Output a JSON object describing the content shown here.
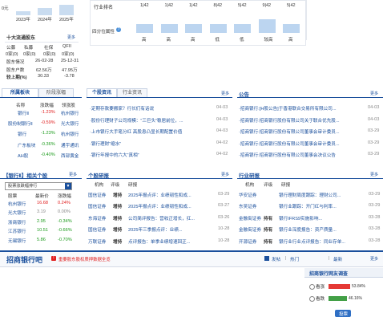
{
  "top_left": {
    "cell_label": "0元",
    "year_labels": [
      "2023年",
      "2024年",
      "2025年"
    ],
    "bar_fill_fractions": [
      0.3,
      0.55,
      0.8
    ]
  },
  "top_ratings": {
    "row1_label": "行业排名",
    "row1_values": [
      "1|42",
      "1|42",
      "1|42",
      "8|42",
      "5|42",
      "9|42",
      "5|42"
    ],
    "row2_label": "四分位属性",
    "row2_help": "?",
    "row2_values": [
      "高",
      "高",
      "高",
      "低",
      "低",
      "较高",
      "高"
    ],
    "bar_fill_fractions": [
      0.35,
      0.35,
      0.35,
      0.35,
      0.35,
      0.55,
      0.35
    ]
  },
  "shareholders": {
    "title": "十大流通股东",
    "more": "更多",
    "headers": [
      "公募",
      "私募",
      "社保",
      "QFII"
    ],
    "counts": [
      "0家(0)",
      "0家(0)",
      "0家(0)",
      "0家(0)"
    ],
    "rows": [
      {
        "label": "股东情况",
        "v1": "26-02-28",
        "v2": "25-12-31"
      },
      {
        "label": "股东户数",
        "v1": "62.56万",
        "v2": "47.95万"
      },
      {
        "label": "较上期(%)",
        "v1": "30.33",
        "v2": "-3.78"
      }
    ]
  },
  "sector": {
    "tabs": [
      "所属板块",
      "阶段涨幅"
    ],
    "headers": [
      "名称",
      "涨跌幅",
      "领涨股"
    ],
    "rows": [
      {
        "name": "银行Ⅱ",
        "change": "-1.23%",
        "leader": "杭州银行",
        "color": "red"
      },
      {
        "name": "股份制银行Ⅱ",
        "change": "-0.59%",
        "leader": "光大银行",
        "color": "red"
      },
      {
        "name": "银行",
        "change": "-1.23%",
        "leader": "杭州银行",
        "color": "green"
      },
      {
        "name": "广东板块",
        "change": "-0.36%",
        "leader": "通宇通讯",
        "color": "green"
      },
      {
        "name": "AH股",
        "change": "-0.40%",
        "leader": "西部黄金",
        "color": "green"
      }
    ]
  },
  "news": {
    "tabs": [
      "个股资讯",
      "行业资讯"
    ],
    "more": "更多",
    "items": [
      {
        "title": "·定期存款要搬家？行长们有话说",
        "date": "04-03"
      },
      {
        "title": "·股份行理财子公司规模：“三巨头”稳居前位，...",
        "date": "04-03"
      },
      {
        "title": "·上市银行大手笔分红 高股息凸显长期配置价值",
        "date": "04-03"
      },
      {
        "title": "·银行理财“缩水”",
        "date": "04-02"
      },
      {
        "title": "·银行年报中的六大“真相”",
        "date": "04-02"
      }
    ]
  },
  "notices": {
    "title": "公告",
    "more": "更多",
    "items": [
      {
        "title": "·招商银行:[H股公告]于香港联合交易所有限公司...",
        "date": "04-03"
      },
      {
        "title": "·招商银行:招商银行股份有限公司关于联合优先股...",
        "date": "04-03"
      },
      {
        "title": "·招商银行:招商银行股份有限公司董事会审计委员...",
        "date": "03-29"
      },
      {
        "title": "·招商银行:招商银行股份有限公司董事会审计委员...",
        "date": "03-29"
      },
      {
        "title": "·招商银行:招商银行股份有限公司董事会决议公告",
        "date": "03-29"
      }
    ]
  },
  "related_stocks": {
    "title": "【银行Ⅱ】相关个股",
    "more": "更多",
    "select": "股票涨跌幅排行",
    "headers": [
      "股票",
      "最新价",
      "涨跌幅"
    ],
    "rows": [
      {
        "name": "杭州银行",
        "price": "16.68",
        "change": "0.24%",
        "color": "red"
      },
      {
        "name": "光大银行",
        "price": "3.19",
        "change": "0.00%",
        "color": "grey"
      },
      {
        "name": "浙商银行",
        "price": "2.95",
        "change": "-0.34%",
        "color": "green"
      },
      {
        "name": "江苏银行",
        "price": "10.51",
        "change": "-0.66%",
        "color": "green"
      },
      {
        "name": "无锡银行",
        "price": "5.86",
        "change": "-0.70%",
        "color": "green"
      }
    ]
  },
  "stock_research": {
    "title": "个股研报",
    "more": "更多",
    "headers": [
      "机构",
      "评级",
      "研报"
    ],
    "rows": [
      {
        "org": "国信证券",
        "rating": "增持",
        "text": "2025年报点评：业绩韧性和成...",
        "date": "03-29"
      },
      {
        "org": "国信证券",
        "rating": "增持",
        "text": "2025年报点评：业绩韧性和成...",
        "date": "03-27"
      },
      {
        "org": "东海证券",
        "rating": "增持",
        "text": "公司简评报告：营收正增长，扛...",
        "date": "03-26"
      },
      {
        "org": "国信证券",
        "rating": "增持",
        "text": "2025年三季报点评：业绩...",
        "date": "10-28"
      },
      {
        "org": "万联证券",
        "rating": "增持",
        "text": "点评报告：单季业绩增速回正...",
        "date": "10-28"
      }
    ]
  },
  "industry_research": {
    "title": "行业研报",
    "more": "更多",
    "headers": [
      "机构",
      "评级",
      "研报"
    ],
    "rows": [
      {
        "org": "华安证券",
        "rating": "",
        "text": "银行理财周度跟踪：理财公司...",
        "date": "03-29"
      },
      {
        "org": "东吴证券",
        "rating": "",
        "text": "银行业跟踪：开门红与利率...",
        "date": "03-29"
      },
      {
        "org": "金融街证券",
        "rating": "持有",
        "text": "银行IFRS9实施影响...",
        "date": "03-28"
      },
      {
        "org": "金融街证券",
        "rating": "持有",
        "text": "银行业深度报告：资产质量...",
        "date": "03-28"
      },
      {
        "org": "开源证券",
        "rating": "持有",
        "text": "银行业行业点评报告：同业存单...",
        "date": "03-28"
      }
    ]
  },
  "forum": {
    "title": "招商银行吧",
    "notice": "重要股东股权质押数据全览",
    "actions": [
      "发帖",
      "热门",
      "最新"
    ],
    "more": "更多"
  },
  "survey": {
    "title": "招商银行网友调查",
    "options": [
      {
        "label": "看涨",
        "pct": "53.84%",
        "fraction": 0.5384,
        "color": "#e53935"
      },
      {
        "label": "看跌",
        "pct": "46.16%",
        "fraction": 0.4616,
        "color": "#43a047"
      }
    ],
    "vote_button": "投票"
  }
}
